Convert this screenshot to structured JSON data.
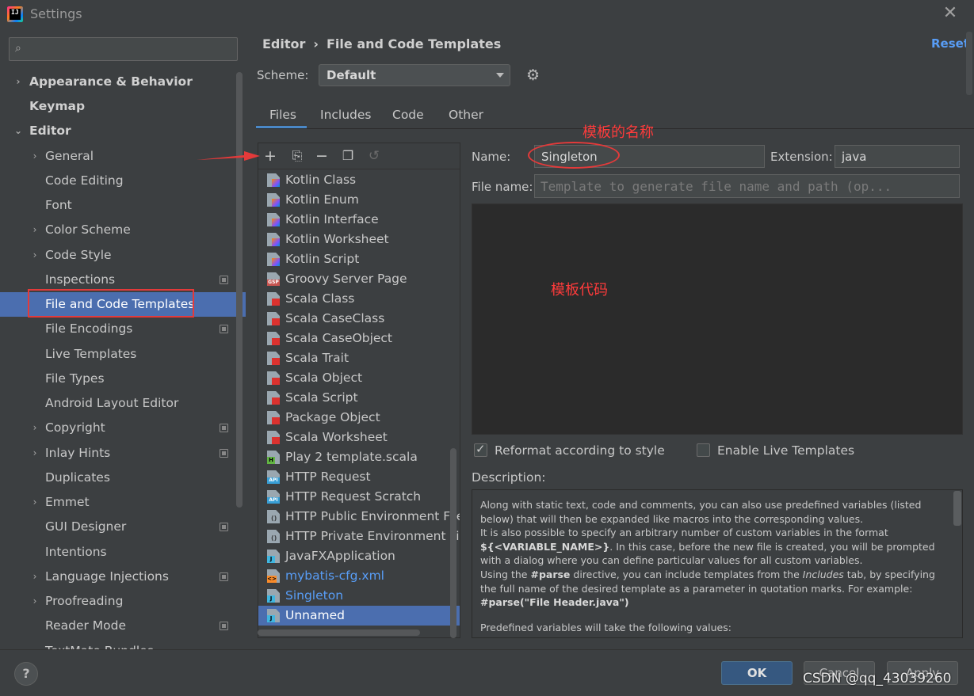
{
  "window": {
    "title": "Settings",
    "close_label": "✕"
  },
  "search": {
    "placeholder": ""
  },
  "sidebar": {
    "items": [
      {
        "label": "Appearance & Behavior"
      },
      {
        "label": "Keymap"
      },
      {
        "label": "Editor"
      },
      {
        "label": "General"
      },
      {
        "label": "Code Editing"
      },
      {
        "label": "Font"
      },
      {
        "label": "Color Scheme"
      },
      {
        "label": "Code Style"
      },
      {
        "label": "Inspections"
      },
      {
        "label": "File and Code Templates"
      },
      {
        "label": "File Encodings"
      },
      {
        "label": "Live Templates"
      },
      {
        "label": "File Types"
      },
      {
        "label": "Android Layout Editor"
      },
      {
        "label": "Copyright"
      },
      {
        "label": "Inlay Hints"
      },
      {
        "label": "Duplicates"
      },
      {
        "label": "Emmet"
      },
      {
        "label": "GUI Designer"
      },
      {
        "label": "Intentions"
      },
      {
        "label": "Language Injections"
      },
      {
        "label": "Proofreading"
      },
      {
        "label": "Reader Mode"
      },
      {
        "label": "TextMate Bundles"
      }
    ]
  },
  "header": {
    "breadcrumb_1": "Editor",
    "breadcrumb_sep": "›",
    "breadcrumb_2": "File and Code Templates",
    "reset_label": "Reset",
    "scheme_label": "Scheme:",
    "scheme_value": "Default"
  },
  "tabs": [
    {
      "label": "Files"
    },
    {
      "label": "Includes"
    },
    {
      "label": "Code"
    },
    {
      "label": "Other"
    }
  ],
  "template_list": [
    {
      "label": "Kotlin Class",
      "icon": "kotlin-file-icon"
    },
    {
      "label": "Kotlin Enum",
      "icon": "kotlin-file-icon"
    },
    {
      "label": "Kotlin Interface",
      "icon": "kotlin-file-icon"
    },
    {
      "label": "Kotlin Worksheet",
      "icon": "kotlin-file-icon"
    },
    {
      "label": "Kotlin Script",
      "icon": "kotlin-file-icon"
    },
    {
      "label": "Groovy Server Page",
      "icon": "gsp-file-icon"
    },
    {
      "label": "Scala Class",
      "icon": "scala-file-icon"
    },
    {
      "label": "Scala CaseClass",
      "icon": "scala-file-icon"
    },
    {
      "label": "Scala CaseObject",
      "icon": "scala-file-icon"
    },
    {
      "label": "Scala Trait",
      "icon": "scala-file-icon"
    },
    {
      "label": "Scala Object",
      "icon": "scala-file-icon"
    },
    {
      "label": "Scala Script",
      "icon": "scala-file-icon"
    },
    {
      "label": "Package Object",
      "icon": "scala-file-icon"
    },
    {
      "label": "Scala Worksheet",
      "icon": "scala-file-icon"
    },
    {
      "label": "Play 2 template.scala",
      "icon": "html-file-icon"
    },
    {
      "label": "HTTP Request",
      "icon": "api-file-icon"
    },
    {
      "label": "HTTP Request Scratch",
      "icon": "api-file-icon"
    },
    {
      "label": "HTTP Public Environment File",
      "icon": "http-env-file-icon"
    },
    {
      "label": "HTTP Private Environment File",
      "icon": "http-env-file-icon"
    },
    {
      "label": "JavaFXApplication",
      "icon": "java-file-icon"
    },
    {
      "label": "mybatis-cfg.xml",
      "icon": "xml-file-icon"
    },
    {
      "label": "Singleton",
      "icon": "java-file-icon"
    },
    {
      "label": "Unnamed",
      "icon": "java-file-icon"
    }
  ],
  "editor": {
    "name_label": "Name:",
    "name_value": "Singleton",
    "extension_label": "Extension:",
    "extension_value": "java",
    "file_name_label": "File name:",
    "file_name_placeholder": "Template to generate file name and path (op...",
    "reformat_label": "Reformat according to style",
    "reformat_checked": true,
    "live_templates_label": "Enable Live Templates",
    "live_templates_checked": false,
    "description_label": "Description:"
  },
  "description": {
    "p1": "Along with static text, code and comments, you can also use predefined variables (listed below) that will then be expanded like macros into the corresponding values.",
    "p2a": "It is also possible to specify an arbitrary number of custom variables in the format",
    "p2_code": "${<VARIABLE_NAME>}",
    "p2b": ". In this case, before the new file is created, you will be prompted with a dialog where you can define particular values for all custom variables.",
    "p3a": "Using the",
    "p3_code": "#parse",
    "p3b": "directive, you can include templates from the",
    "p3_italic": "Includes",
    "p3c": "tab, by specifying the full name of the desired template as a parameter in quotation marks. For example:",
    "p3_example": "#parse(\"File Header.java\")",
    "p4": "Predefined variables will take the following values:"
  },
  "annotations": {
    "name_note": "模板的名称",
    "code_note": "模板代码"
  },
  "footer": {
    "help_label": "?",
    "ok_label": "OK",
    "cancel_label": "Cancel",
    "apply_label": "Apply",
    "watermark": "CSDN @qq_43039260"
  },
  "colors": {
    "selection": "#4b6eaf",
    "link": "#589df6",
    "annotation_red": "#e33a3a",
    "ok_button": "#365880"
  }
}
